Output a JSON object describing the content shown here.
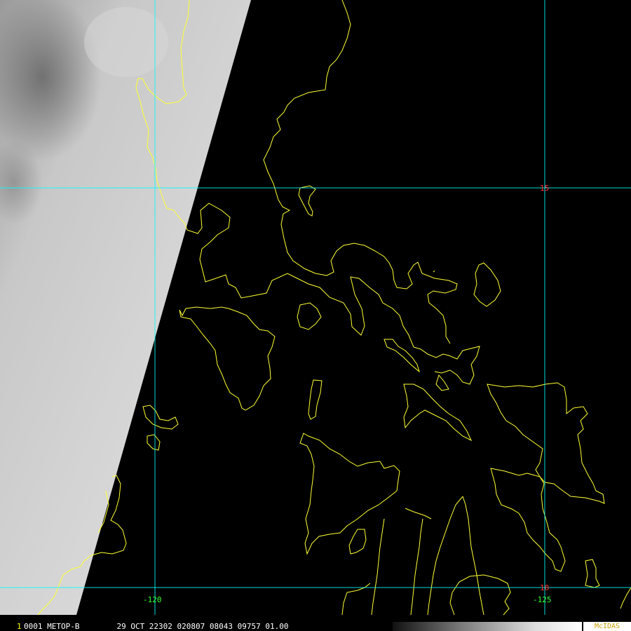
{
  "map": {
    "latitude_lines": [
      {
        "value": 15,
        "label": "15"
      },
      {
        "value": 10,
        "label": "10"
      }
    ],
    "longitude_lines": [
      {
        "value": -120,
        "label": "-120"
      },
      {
        "value": -125,
        "label": "-125"
      }
    ],
    "colors": {
      "coastline": "#ffff33",
      "grid": "#00ffff",
      "latitude_label": "#ff3333",
      "longitude_label": "#33ff33"
    }
  },
  "status_bar": {
    "frame_number": "1",
    "text": "0001 METOP-B        29 OCT 22302 020807 08043 09757 01.00",
    "brand": "McIDAS"
  }
}
